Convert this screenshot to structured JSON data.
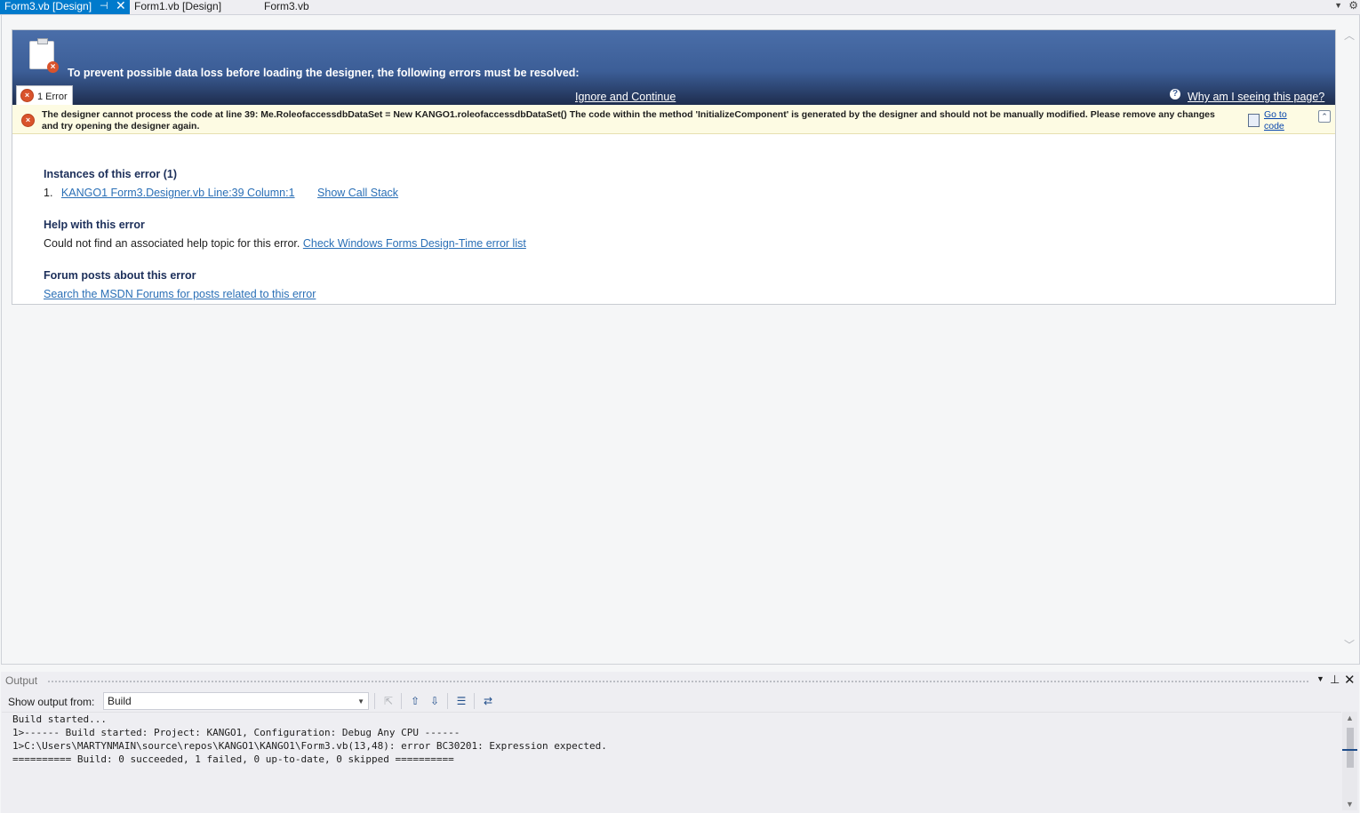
{
  "tabs": [
    {
      "label": "Form3.vb [Design]",
      "active": true
    },
    {
      "label": "Form1.vb [Design]",
      "active": false
    },
    {
      "label": "Form3.vb",
      "active": false
    }
  ],
  "icons": {
    "pin": "pin-icon",
    "close": "close-icon",
    "dropdown": "chevron-down-icon",
    "settings": "gear-icon"
  },
  "error_panel": {
    "banner_title": "To prevent possible data loss before loading the designer, the following errors must be resolved:",
    "error_tab_label": "1 Error",
    "ignore_label": "Ignore and Continue",
    "why_label": "Why am I seeing this page?",
    "message": "The designer cannot process the code at line 39: Me.RoleofaccessdbDataSet = New KANGO1.roleofaccessdbDataSet() The code within the method 'InitializeComponent' is generated by the designer and should not be manually modified. Please remove any changes and try opening the designer again.",
    "goto_code_label": "Go to code",
    "instances_heading": "Instances of this error (1)",
    "instance_number": "1.",
    "instance_link": "KANGO1 Form3.Designer.vb Line:39 Column:1",
    "show_call_stack": "Show Call Stack",
    "help_heading": "Help with this error",
    "help_text": "Could not find an associated help topic for this error.",
    "help_link": "Check Windows Forms Design-Time error list",
    "forum_heading": "Forum posts about this error",
    "forum_link": "Search the MSDN Forums for posts related to this error"
  },
  "output": {
    "title": "Output",
    "show_from_label": "Show output from:",
    "show_from_value": "Build",
    "lines": [
      "Build started...",
      "1>------ Build started: Project: KANGO1, Configuration: Debug Any CPU ------",
      "1>C:\\Users\\MARTYNMAIN\\source\\repos\\KANGO1\\KANGO1\\Form3.vb(13,48): error BC30201: Expression expected.",
      "========== Build: 0 succeeded, 1 failed, 0 up-to-date, 0 skipped =========="
    ]
  },
  "colors": {
    "accent": "#007acc",
    "banner": "#3c5e97",
    "error_red": "#d9532c",
    "link": "#2a6fb6",
    "yellow_bar": "#fdfbe3"
  }
}
